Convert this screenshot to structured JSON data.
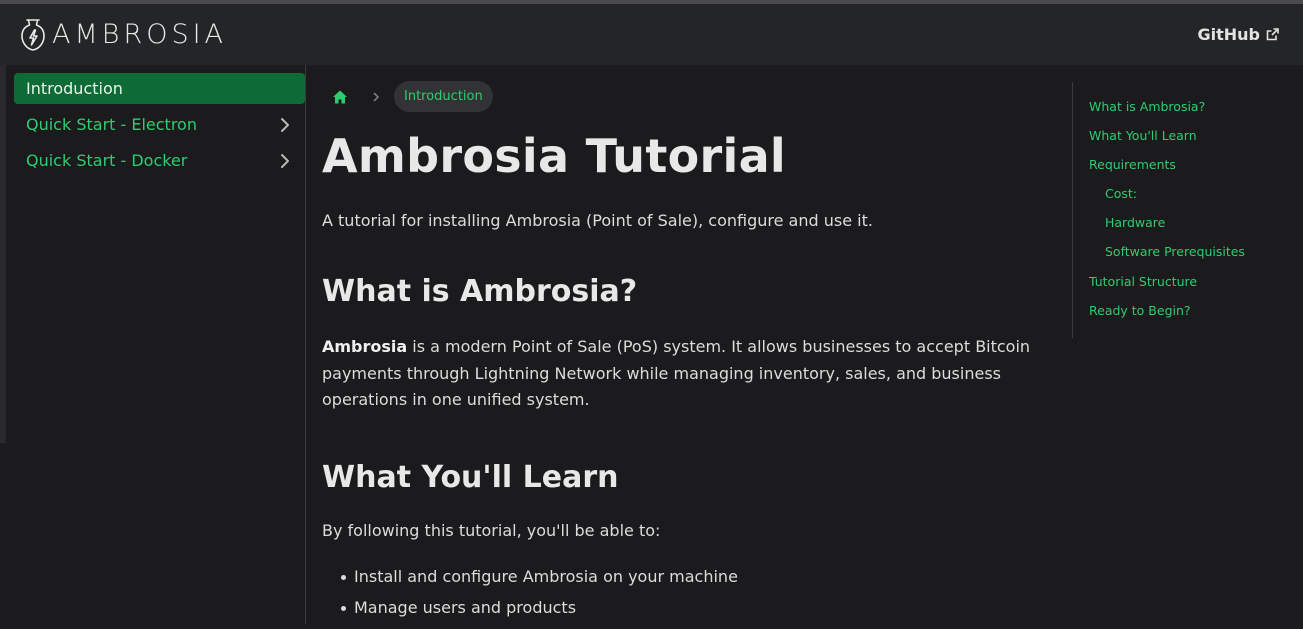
{
  "navbar": {
    "brand": "AMBROSIA",
    "github_label": "GitHub"
  },
  "icons": {
    "logo": "amphora-logo-icon",
    "external": "external-link-icon",
    "home": "home-icon",
    "chevron": "chevron-right-icon"
  },
  "sidebar": {
    "items": [
      {
        "label": "Introduction",
        "active": true,
        "expandable": false
      },
      {
        "label": "Quick Start - Electron",
        "active": false,
        "expandable": true
      },
      {
        "label": "Quick Start - Docker",
        "active": false,
        "expandable": true
      }
    ]
  },
  "breadcrumb": {
    "current": "Introduction"
  },
  "content": {
    "title": "Ambrosia Tutorial",
    "lead": "A tutorial for installing Ambrosia (Point of Sale), configure and use it.",
    "section1": {
      "heading": "What is Ambrosia?",
      "bold": "Ambrosia",
      "text": " is a modern Point of Sale (PoS) system. It allows businesses to accept Bitcoin payments through Lightning Network while managing inventory, sales, and business operations in one unified system."
    },
    "section2": {
      "heading": "What You'll Learn",
      "intro": "By following this tutorial, you'll be able to:",
      "items": [
        "Install and configure Ambrosia on your machine",
        "Manage users and products"
      ]
    }
  },
  "toc": {
    "items": [
      {
        "label": "What is Ambrosia?",
        "level": 1
      },
      {
        "label": "What You'll Learn",
        "level": 1
      },
      {
        "label": "Requirements",
        "level": 1
      },
      {
        "label": "Cost:",
        "level": 2
      },
      {
        "label": "Hardware",
        "level": 2
      },
      {
        "label": "Software Prerequisites",
        "level": 2
      },
      {
        "label": "Tutorial Structure",
        "level": 1
      },
      {
        "label": "Ready to Begin?",
        "level": 1
      }
    ]
  },
  "colors": {
    "accent": "#2ecc71",
    "active_bg": "#0e6b36",
    "navbar_bg": "#242526",
    "page_bg": "#1b1b1d"
  }
}
